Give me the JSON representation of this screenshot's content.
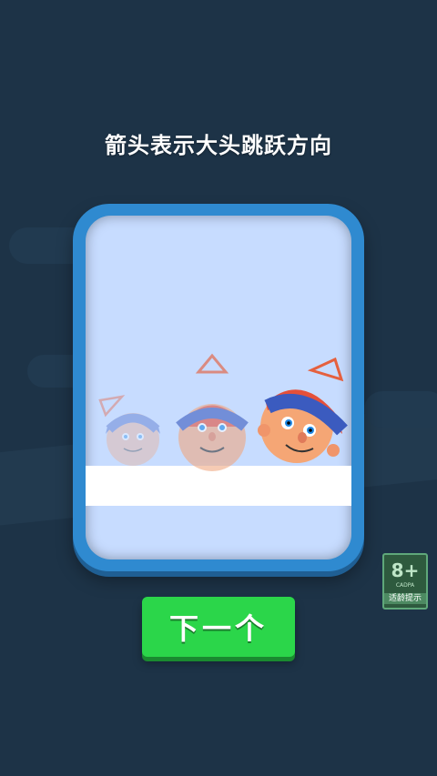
{
  "tutorial": {
    "instruction": "箭头表示大头跳跃方向"
  },
  "buttons": {
    "next_label": "下一个"
  },
  "age_rating": {
    "rating": "8+",
    "code": "CADPA",
    "hint": "适龄提示"
  },
  "colors": {
    "background": "#1d3347",
    "card_frame": "#2f8ad0",
    "card_inner": "#c7dcff",
    "next_button": "#2bd64a",
    "arrow": "#e5603e",
    "hat_blue": "#3b5bbf",
    "hat_red": "#e5503a",
    "skin": "#f5a675"
  }
}
